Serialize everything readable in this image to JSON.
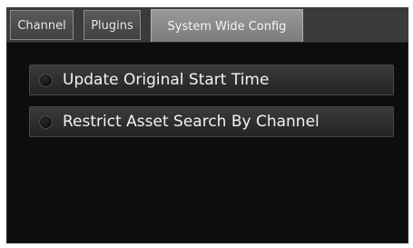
{
  "tabs": [
    {
      "label": "Channel",
      "active": false
    },
    {
      "label": "Plugins",
      "active": false
    },
    {
      "label": "System Wide Config",
      "active": true
    }
  ],
  "options": [
    {
      "label": "Update Original Start Time",
      "state": "off",
      "icon": "radio-led-icon"
    },
    {
      "label": "Restrict Asset Search By Channel",
      "state": "off",
      "icon": "radio-led-icon"
    }
  ],
  "colors": {
    "panel_bg": "#0d0d0d",
    "tab_active": "#8a8a8a",
    "tab_inactive": "#4a4a4a",
    "text": "#f2f2f2"
  }
}
